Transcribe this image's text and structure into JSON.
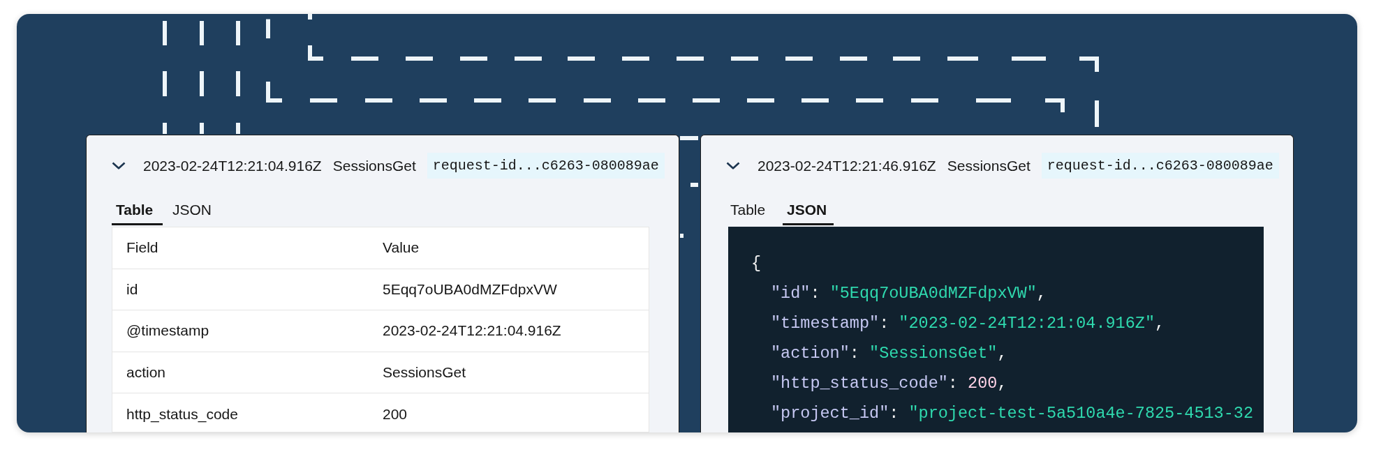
{
  "panels": [
    {
      "header": {
        "expanded": true,
        "timestamp": "2023-02-24T12:21:04.916Z",
        "action": "SessionsGet",
        "request_id": "request-id...c6263-080089ae"
      },
      "tabs": [
        {
          "label": "Table",
          "selected": true
        },
        {
          "label": "JSON",
          "selected": false
        }
      ],
      "view": {
        "kind": "table",
        "columns": [
          "Field",
          "Value"
        ],
        "rows": [
          [
            "id",
            "5Eqq7oUBA0dMZFdpxVW"
          ],
          [
            "@timestamp",
            "2023-02-24T12:21:04.916Z"
          ],
          [
            "action",
            "SessionsGet"
          ],
          [
            "http_status_code",
            "200"
          ]
        ]
      }
    },
    {
      "header": {
        "expanded": true,
        "timestamp": "2023-02-24T12:21:46.916Z",
        "action": "SessionsGet",
        "request_id": "request-id...c6263-080089ae"
      },
      "tabs": [
        {
          "label": "Table",
          "selected": false
        },
        {
          "label": "JSON",
          "selected": true
        }
      ],
      "view": {
        "kind": "json",
        "open": "{",
        "entries": [
          {
            "key": "\"id\"",
            "colon": ": ",
            "kind": "string",
            "value": "\"5Eqq7oUBA0dMZFdpxVW\"",
            "comma": ","
          },
          {
            "key": "\"timestamp\"",
            "colon": ": ",
            "kind": "string",
            "value": "\"2023-02-24T12:21:04.916Z\"",
            "comma": ","
          },
          {
            "key": "\"action\"",
            "colon": ": ",
            "kind": "string",
            "value": "\"SessionsGet\"",
            "comma": ","
          },
          {
            "key": "\"http_status_code\"",
            "colon": ": ",
            "kind": "number",
            "value": "200",
            "comma": ","
          },
          {
            "key": "\"project_id\"",
            "colon": ": ",
            "kind": "string",
            "value": "\"project-test-5a510a4e-7825-4513-32"
          }
        ]
      }
    }
  ]
}
